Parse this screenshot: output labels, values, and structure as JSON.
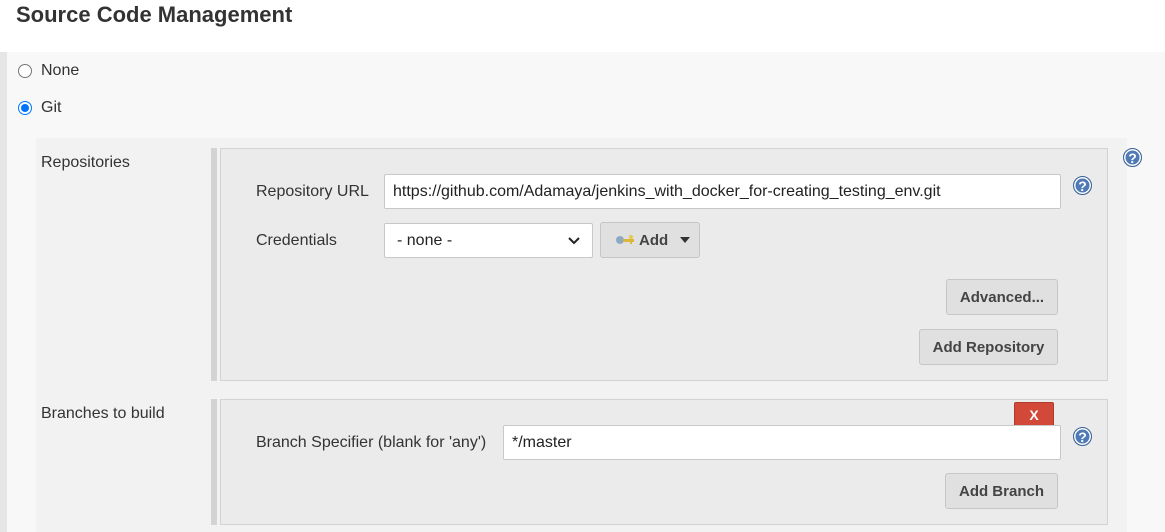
{
  "section": {
    "title": "Source Code Management"
  },
  "scm_options": [
    {
      "label": "None",
      "checked": false
    },
    {
      "label": "Git",
      "checked": true
    }
  ],
  "repositories": {
    "label": "Repositories",
    "url_label": "Repository URL",
    "url_value": "https://github.com/Adamaya/jenkins_with_docker_for-creating_testing_env.git",
    "credentials_label": "Credentials",
    "credentials_selected": "- none -",
    "add_label": "Add",
    "advanced_label": "Advanced...",
    "add_repository_label": "Add Repository"
  },
  "branches": {
    "label": "Branches to build",
    "delete_label": "X",
    "specifier_label": "Branch Specifier (blank for 'any')",
    "specifier_value": "*/master",
    "add_branch_label": "Add Branch"
  },
  "help_glyph": "?",
  "icons": [
    "key-icon",
    "caret-down-icon",
    "help-icon"
  ],
  "colors": {
    "accent": "#0075ff",
    "help": "#4f7ab5",
    "delete": "#d24939",
    "panel": "#ebebeb"
  }
}
